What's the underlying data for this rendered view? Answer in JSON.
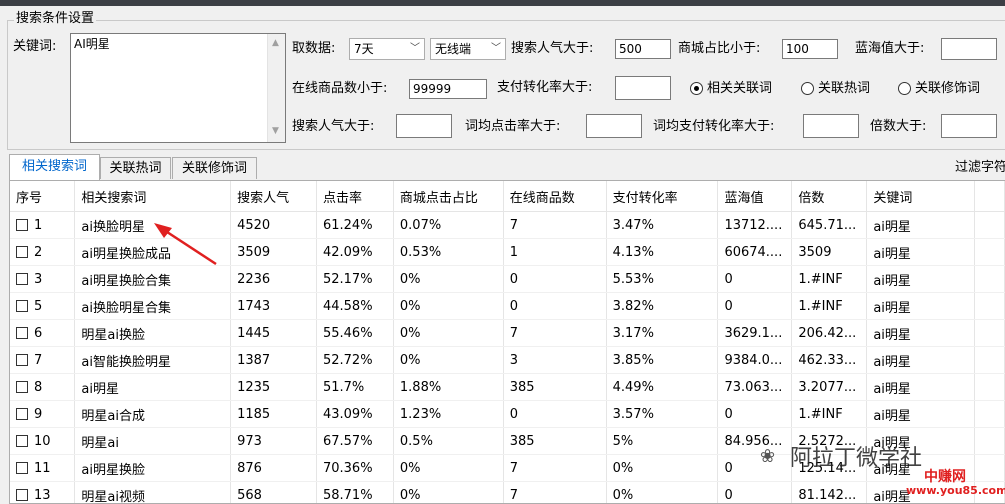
{
  "group_title": "搜索条件设置",
  "keyword": {
    "label": "关键词:",
    "value": "AI明星"
  },
  "row1": {
    "fetch_label": "取数据:",
    "period": "7天",
    "device": "无线端",
    "search_pop_gt_label": "搜索人气大于:",
    "search_pop_gt_value": "500",
    "mall_ratio_lt_label": "商城占比小于:",
    "mall_ratio_lt_value": "100",
    "blue_ocean_gt_label": "蓝海值大于:",
    "blue_ocean_gt_value": ""
  },
  "row2": {
    "online_items_lt_label": "在线商品数小于:",
    "online_items_lt_value": "99999",
    "pay_conv_gt_label": "支付转化率大于:",
    "pay_conv_gt_value": "",
    "radio_related": "相关关联词",
    "radio_hot": "关联热词",
    "radio_modifier": "关联修饰词"
  },
  "row3": {
    "search_pop_gt2_label": "搜索人气大于:",
    "avg_click_gt_label": "词均点击率大于:",
    "avg_pay_conv_gt_label": "词均支付转化率大于:",
    "multiple_gt_label": "倍数大于:"
  },
  "tabs": [
    "相关搜索词",
    "关联热词",
    "关联修饰词"
  ],
  "filter_label": "过滤字符",
  "table": {
    "headers": [
      "序号",
      "相关搜索词",
      "搜索人气",
      "点击率",
      "商城点击占比",
      "在线商品数",
      "支付转化率",
      "蓝海值",
      "倍数",
      "关键词"
    ],
    "rows": [
      [
        "1",
        "ai换脸明星",
        "4520",
        "61.24%",
        "0.07%",
        "7",
        "3.47%",
        "13712....",
        "645.71...",
        "ai明星"
      ],
      [
        "2",
        "ai明星换脸成品",
        "3509",
        "42.09%",
        "0.53%",
        "1",
        "4.13%",
        "60674....",
        "3509",
        "ai明星"
      ],
      [
        "3",
        "ai明星换脸合集",
        "2236",
        "52.17%",
        "0%",
        "0",
        "5.53%",
        "0",
        "1.#INF",
        "ai明星"
      ],
      [
        "5",
        "ai换脸明星合集",
        "1743",
        "44.58%",
        "0%",
        "0",
        "3.82%",
        "0",
        "1.#INF",
        "ai明星"
      ],
      [
        "6",
        "明星ai换脸",
        "1445",
        "55.46%",
        "0%",
        "7",
        "3.17%",
        "3629.1...",
        "206.42...",
        "ai明星"
      ],
      [
        "7",
        "ai智能换脸明星",
        "1387",
        "52.72%",
        "0%",
        "3",
        "3.85%",
        "9384.0...",
        "462.33...",
        "ai明星"
      ],
      [
        "8",
        "ai明星",
        "1235",
        "51.7%",
        "1.88%",
        "385",
        "4.49%",
        "73.063...",
        "3.2077...",
        "ai明星"
      ],
      [
        "9",
        "明星ai合成",
        "1185",
        "43.09%",
        "1.23%",
        "0",
        "3.57%",
        "0",
        "1.#INF",
        "ai明星"
      ],
      [
        "10",
        "明星ai",
        "973",
        "67.57%",
        "0.5%",
        "385",
        "5%",
        "84.956...",
        "2.5272...",
        "ai明星"
      ],
      [
        "11",
        "ai明星换脸",
        "876",
        "70.36%",
        "0%",
        "7",
        "0%",
        "0",
        "125.14...",
        "ai明星"
      ],
      [
        "13",
        "明星ai视频",
        "568",
        "58.71%",
        "0%",
        "7",
        "0%",
        "0",
        "81.142...",
        "ai明星"
      ]
    ]
  },
  "watermark": "阿拉丁微学社",
  "brand_cn": "中赚网",
  "brand_url": "www.you85.com",
  "colors": {
    "accent": "#0066cc",
    "arrow": "#e02020"
  }
}
